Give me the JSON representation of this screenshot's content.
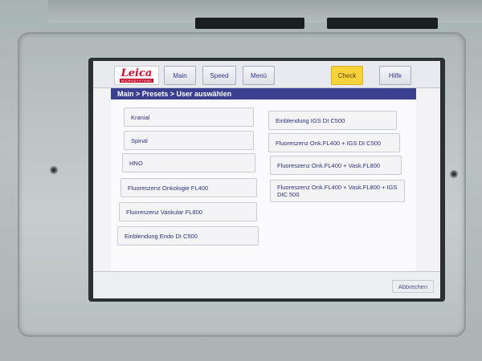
{
  "toolbar": {
    "logo_text": "Leica",
    "logo_subtext": "MICROSYSTEMS",
    "main_label": "Main",
    "speed_label": "Speed",
    "menu_label": "Menü",
    "check_label": "Check",
    "help_label": "Hilfe",
    "check_color": "#f7d23a"
  },
  "breadcrumb": "Main > Presets > User auswählen",
  "presets_left": [
    "Kranial",
    "Spinal",
    "HNO",
    "Fluoreszenz Onkologie FL400",
    "Fluoreszenz Vaskular FL800",
    "Einblendung Endo DI C500"
  ],
  "presets_right": [
    "Einblendung IGS DI C500",
    "Fluoreszenz Onk.FL400 + IGS DI C500",
    "Fluoreszenz Onk.FL400 + Vask.FL800",
    "Fluoreszenz Onk.FL400 + Vask.FL800 + IGS DIC 500"
  ],
  "footer": {
    "cancel_label": "Abbrechen"
  }
}
